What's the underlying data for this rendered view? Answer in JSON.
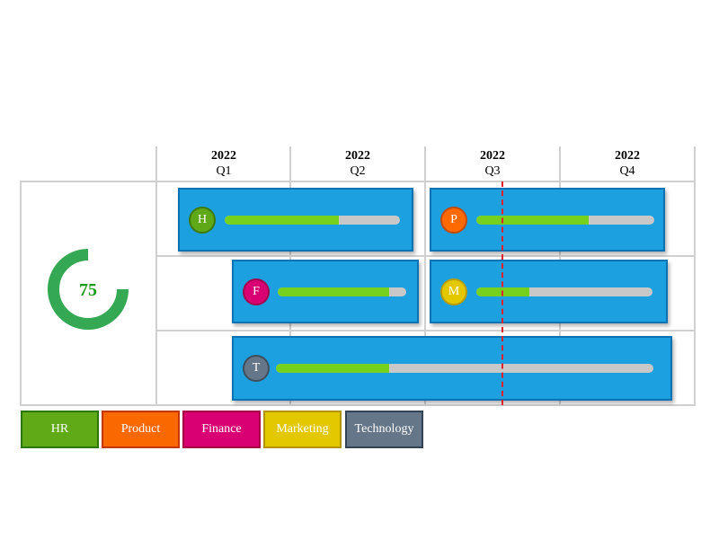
{
  "columns": [
    {
      "year": "2022",
      "quarter": "Q1"
    },
    {
      "year": "2022",
      "quarter": "Q2"
    },
    {
      "year": "2022",
      "quarter": "Q3"
    },
    {
      "year": "2022",
      "quarter": "Q4"
    }
  ],
  "gauge": {
    "value": "75",
    "percent": 75,
    "color": "#34a853",
    "text_color": "#1a9a1a"
  },
  "tasks": [
    {
      "initial": "H",
      "department": "HR",
      "progress": 65,
      "color": "#5fa818",
      "border": "#3d7a0c"
    },
    {
      "initial": "P",
      "department": "Product",
      "progress": 63,
      "color": "#ff6a00",
      "border": "#c44a00"
    },
    {
      "initial": "F",
      "department": "Finance",
      "progress": 87,
      "color": "#d80073",
      "border": "#a0004f"
    },
    {
      "initial": "M",
      "department": "Marketing",
      "progress": 30,
      "color": "#e3c800",
      "border": "#b89e00"
    },
    {
      "initial": "T",
      "department": "Technology",
      "progress": 30,
      "color": "#647687",
      "border": "#3f4e5c"
    }
  ],
  "legend": [
    {
      "label": "HR",
      "color": "#60a917",
      "border": "#2d7600"
    },
    {
      "label": "Product",
      "color": "#fa6800",
      "border": "#c73500"
    },
    {
      "label": "Finance",
      "color": "#d80073",
      "border": "#a50040"
    },
    {
      "label": "Marketing",
      "color": "#e3c800",
      "border": "#b09500"
    },
    {
      "label": "Technology",
      "color": "#647687",
      "border": "#314354"
    }
  ],
  "colors": {
    "bar": "#1ca0e0",
    "bar_border": "#0b72b5",
    "progress": "#76d11f",
    "track": "#c8c8c8",
    "today_line": "#e0202a"
  }
}
